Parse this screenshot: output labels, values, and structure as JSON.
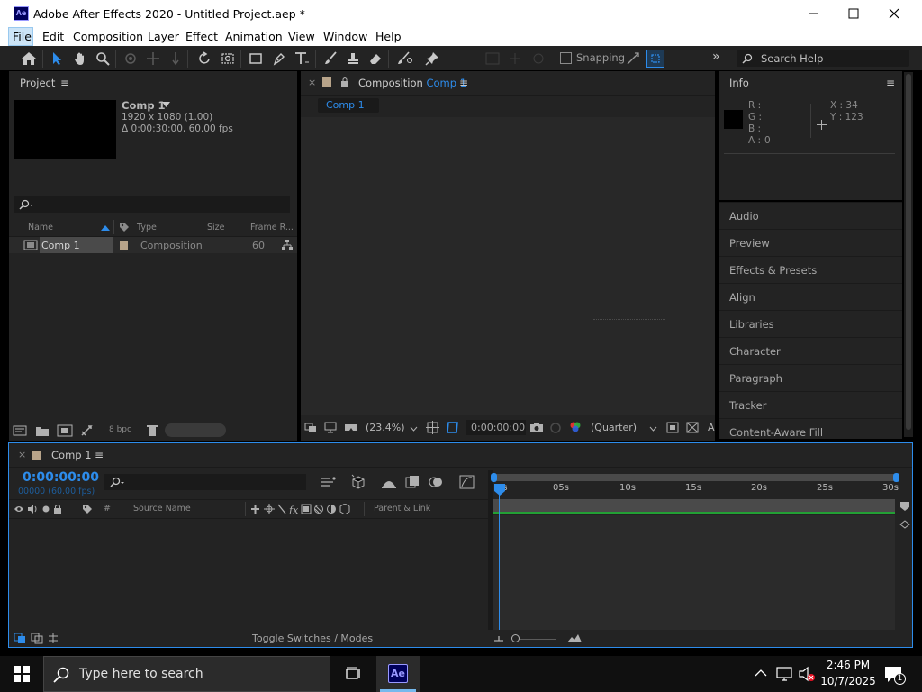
{
  "window": {
    "title": "Adobe After Effects 2020 - Untitled Project.aep *",
    "app_icon": "Ae"
  },
  "menu": [
    "File",
    "Edit",
    "Composition",
    "Layer",
    "Effect",
    "Animation",
    "View",
    "Window",
    "Help"
  ],
  "toolbar": {
    "snapping_label": "Snapping",
    "search_placeholder": "Search Help"
  },
  "project": {
    "panel_title": "Project",
    "comp_name": "Comp 1",
    "comp_resolution": "1920 x 1080 (1.00)",
    "comp_duration": "Δ 0:00:30:00, 60.00 fps",
    "columns": [
      "Name",
      "Type",
      "Size",
      "Frame R..."
    ],
    "items": [
      {
        "name": "Comp 1",
        "type": "Composition",
        "size": "",
        "frame_rate": "60"
      }
    ],
    "bpc": "8 bpc"
  },
  "composition": {
    "tab_prefix": "Composition",
    "tab_comp": "Comp 1",
    "breadcrumb": "Comp 1",
    "zoom": "(23.4%)",
    "timecode": "0:00:00:00",
    "resolution": "(Quarter)"
  },
  "info": {
    "panel_title": "Info",
    "r_label": "R :",
    "g_label": "G :",
    "b_label": "B :",
    "a_label": "A :",
    "a_value": "0",
    "x_readout": "X : 34",
    "y_readout": "Y : 123"
  },
  "side_panels": [
    "Audio",
    "Preview",
    "Effects & Presets",
    "Align",
    "Libraries",
    "Character",
    "Paragraph",
    "Tracker",
    "Content-Aware Fill"
  ],
  "timeline": {
    "tab_title": "Comp 1",
    "timecode": "0:00:00:00",
    "frame_info": "00000 (60.00 fps)",
    "columns": {
      "source_name": "Source Name",
      "parent": "Parent & Link",
      "hash": "#"
    },
    "ruler": [
      "0s",
      "05s",
      "10s",
      "15s",
      "20s",
      "25s",
      "30s"
    ],
    "toggle_label": "Toggle Switches / Modes"
  },
  "taskbar": {
    "search_placeholder": "Type here to search",
    "app_label": "Ae",
    "time": "2:46 PM",
    "date": "10/7/2025",
    "notification_count": "1"
  },
  "colors": {
    "accent": "#2d8ceb",
    "panel_bg": "#232323",
    "work_area_green": "#23a035",
    "ae_brand": "#00005b"
  }
}
